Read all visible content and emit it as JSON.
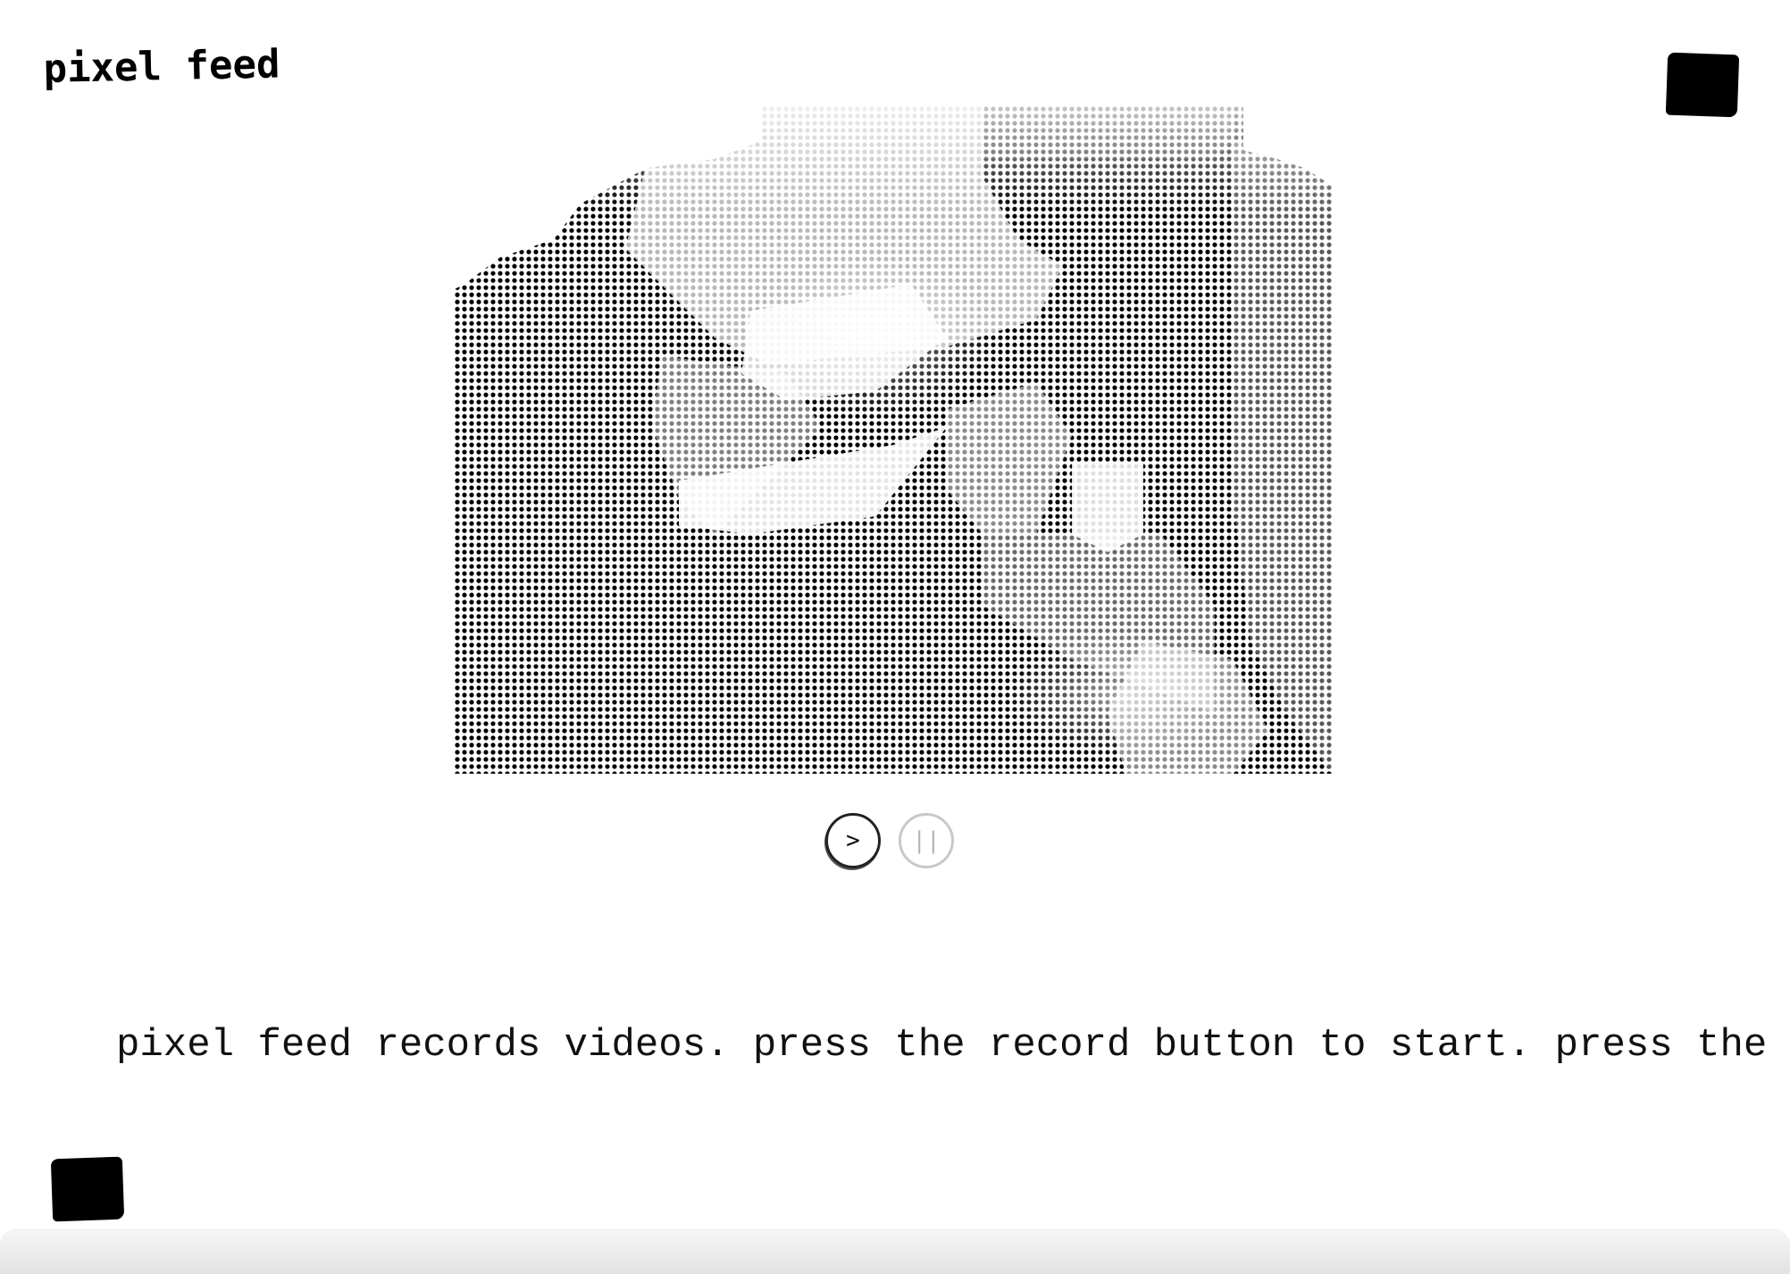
{
  "app": {
    "title": "pixel feed"
  },
  "video": {
    "play_label": ">",
    "pause_label": "||"
  },
  "info": {
    "marquee_text": "pixel feed records videos. press the record button to start. press the"
  },
  "icons": {
    "record_top": "black-square-icon",
    "record_bottom": "black-square-icon"
  },
  "colors": {
    "background": "#ffffff",
    "ink": "#000000",
    "pause_disabled": "#c8c8c8"
  }
}
